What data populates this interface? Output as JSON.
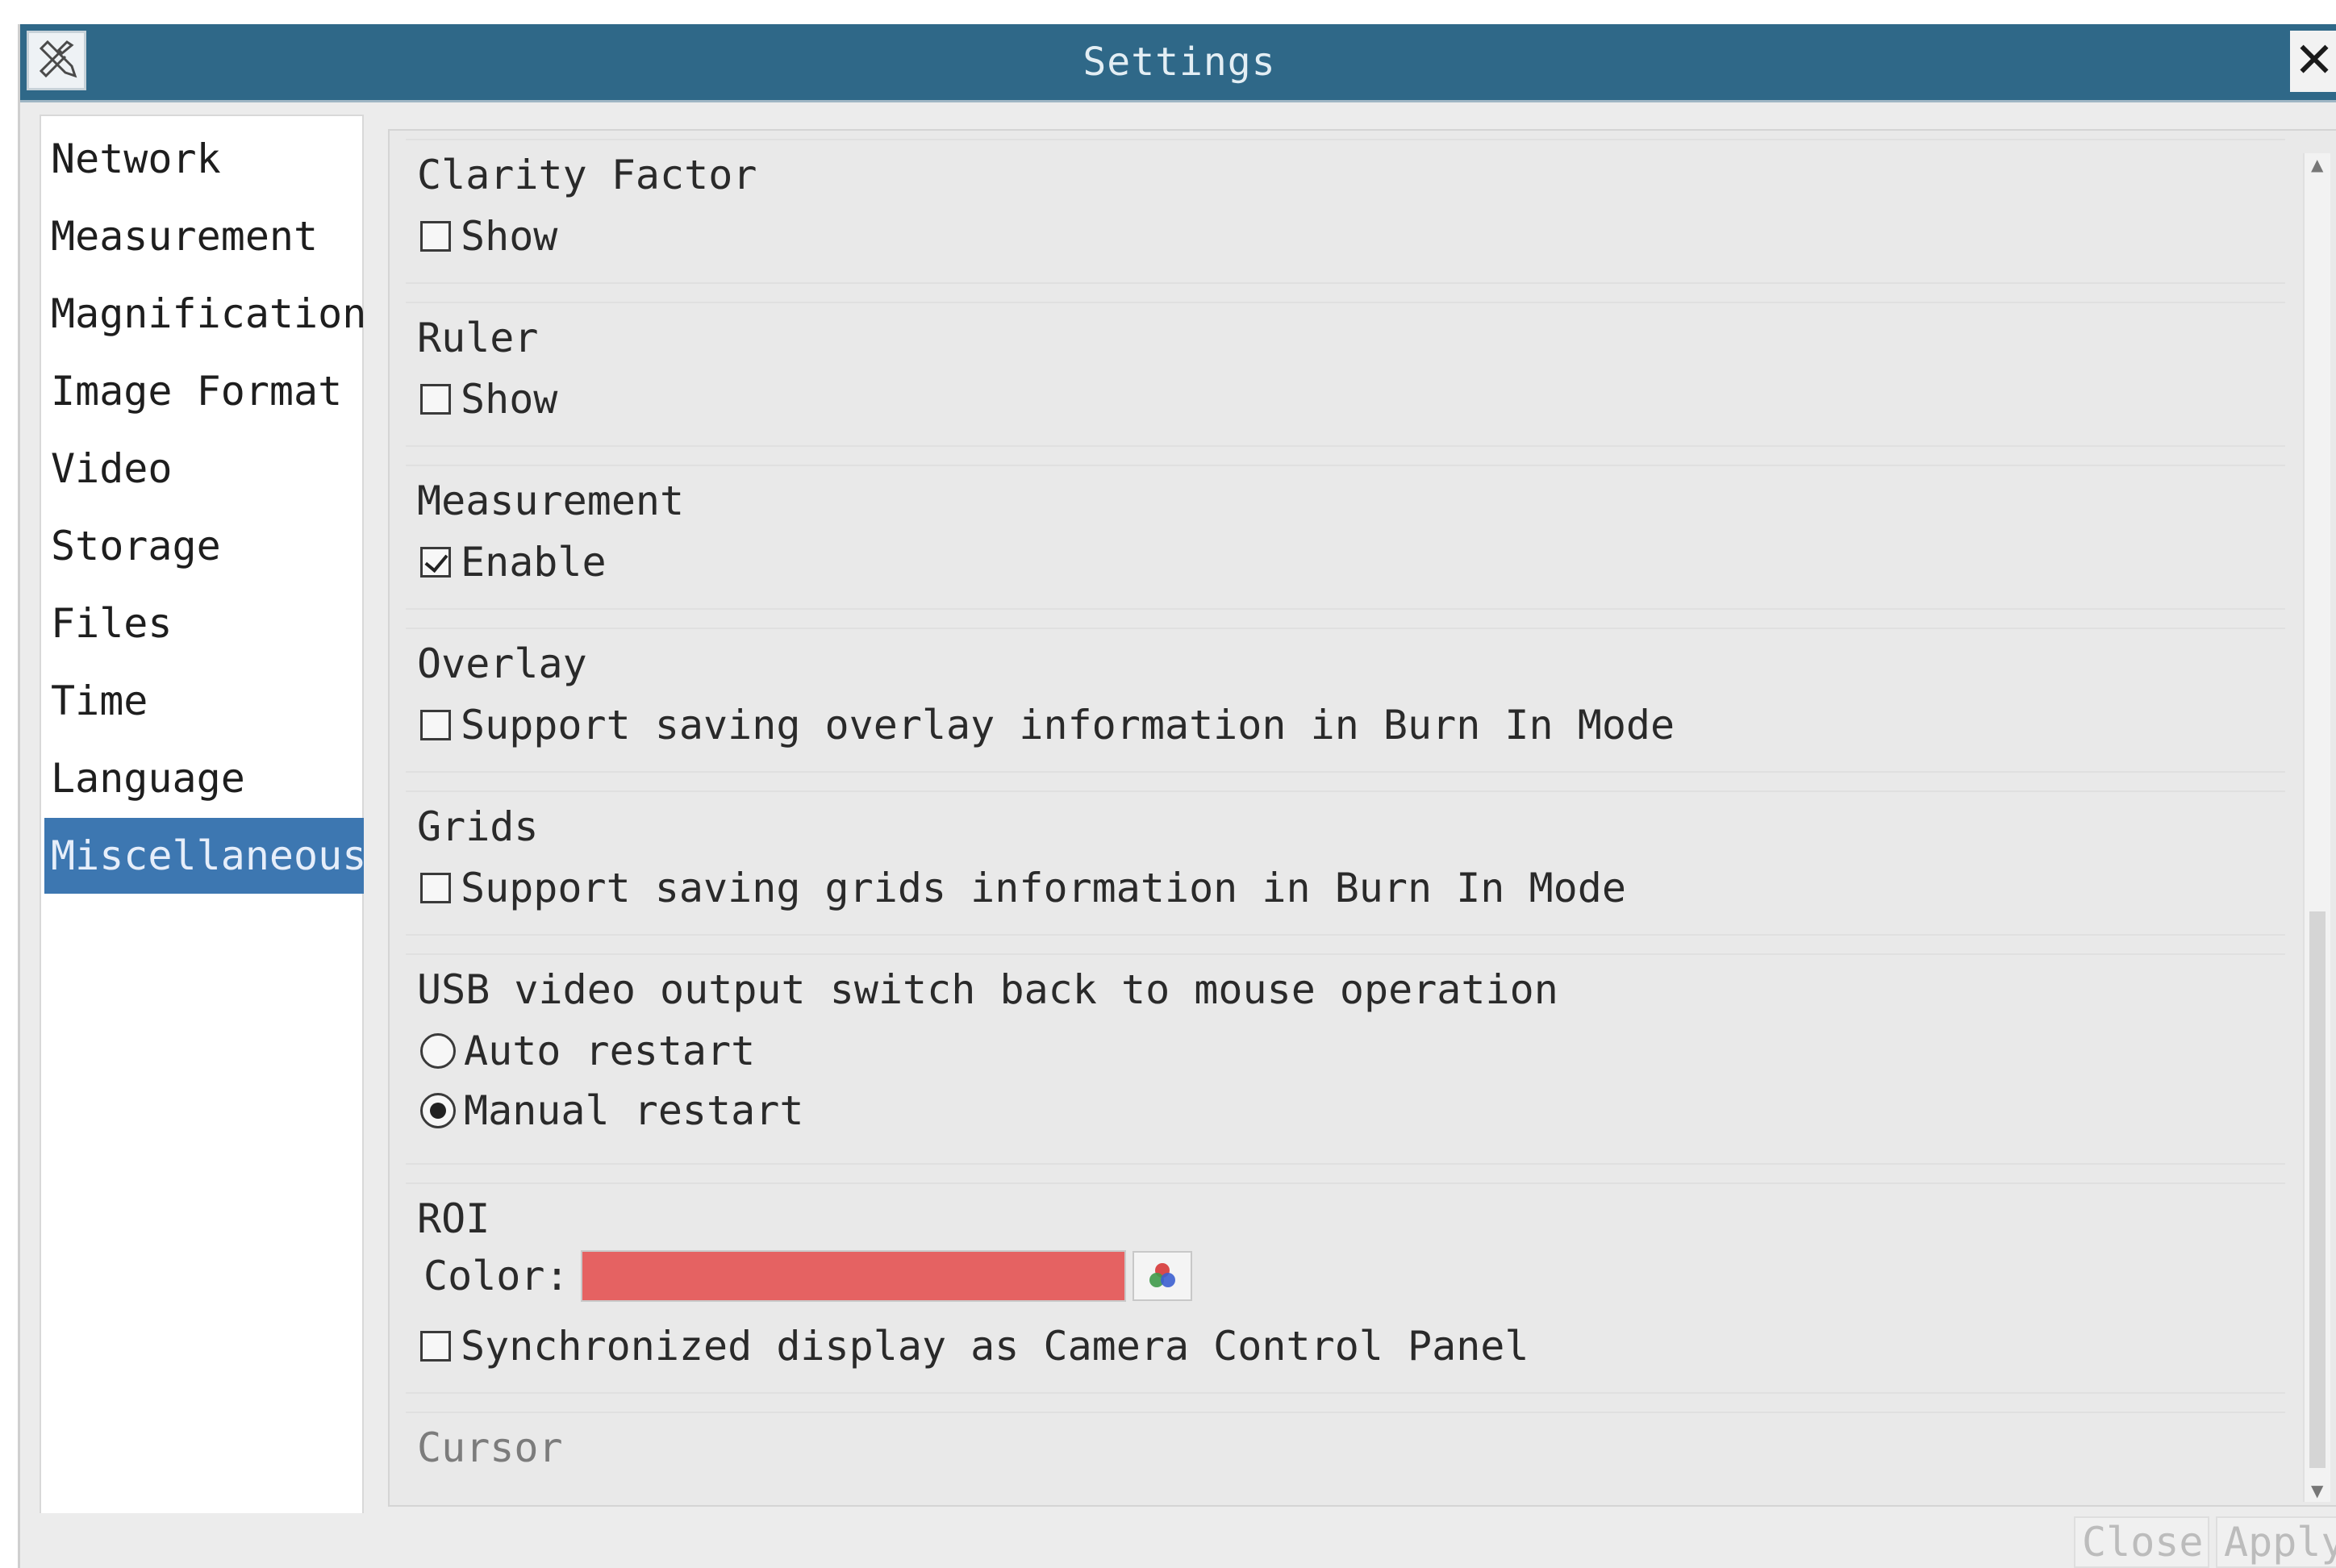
{
  "window": {
    "title": "Settings",
    "close_glyph": "✕",
    "icon": "tools-icon"
  },
  "sidebar": {
    "items": [
      {
        "label": "Network"
      },
      {
        "label": "Measurement"
      },
      {
        "label": "Magnification"
      },
      {
        "label": "Image Format"
      },
      {
        "label": "Video"
      },
      {
        "label": "Storage"
      },
      {
        "label": "Files"
      },
      {
        "label": "Time"
      },
      {
        "label": "Language"
      },
      {
        "label": "Miscellaneous",
        "selected": true
      }
    ]
  },
  "panel": {
    "clarity": {
      "title": "Clarity Factor",
      "option": "Show",
      "checked": false
    },
    "ruler": {
      "title": "Ruler",
      "option": "Show",
      "checked": false
    },
    "measurement": {
      "title": "Measurement",
      "option": "Enable",
      "checked": true
    },
    "overlay": {
      "title": "Overlay",
      "option": "Support saving overlay information in Burn In Mode",
      "checked": false
    },
    "grids": {
      "title": "Grids",
      "option": "Support saving grids information in Burn In Mode",
      "checked": false
    },
    "usb": {
      "title": "USB video output switch back to mouse operation",
      "options": [
        {
          "label": "Auto restart",
          "selected": false
        },
        {
          "label": "Manual restart",
          "selected": true
        }
      ]
    },
    "roi": {
      "title": "ROI",
      "color_label": "Color:",
      "color_value": "#e56262",
      "sync_option": "Synchronized display as Camera Control Panel",
      "sync_checked": false
    },
    "cursor": {
      "title": "Cursor"
    }
  },
  "footer": {
    "close_label": "Close",
    "apply_label": "Apply"
  },
  "colors": {
    "titlebar": "#2f6888",
    "selection": "#3d77b1",
    "roi_swatch": "#e56262"
  }
}
